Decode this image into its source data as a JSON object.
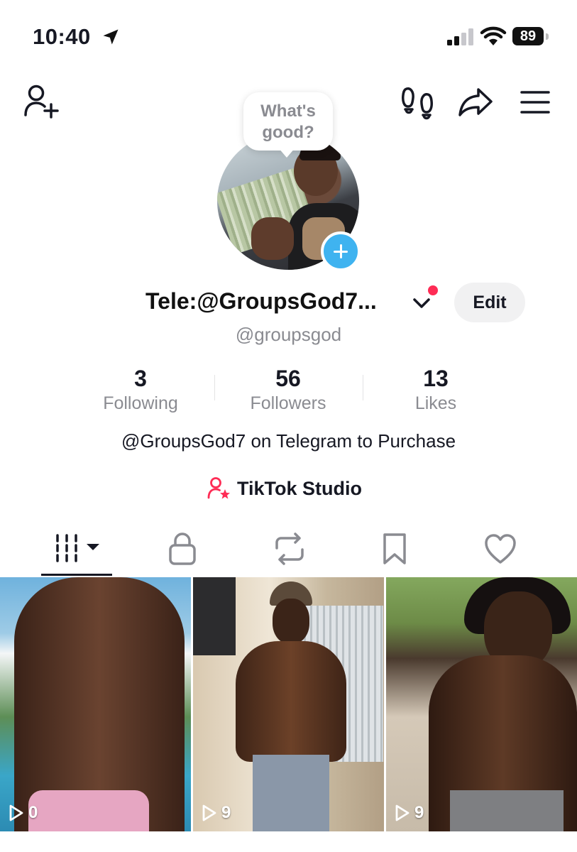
{
  "status_bar": {
    "time": "10:40",
    "battery": "89"
  },
  "profile": {
    "bubble_text": "What's good?",
    "display_name": "Tele:@GroupsGod7...",
    "handle": "@groupsgod",
    "edit_label": "Edit",
    "bio": "@GroupsGod7 on Telegram to Purchase",
    "studio_label": "TikTok Studio"
  },
  "stats": [
    {
      "value": "3",
      "label": "Following"
    },
    {
      "value": "56",
      "label": "Followers"
    },
    {
      "value": "13",
      "label": "Likes"
    }
  ],
  "tabs": [
    {
      "icon": "videos-grid-icon",
      "active": true
    },
    {
      "icon": "lock-icon",
      "active": false
    },
    {
      "icon": "repost-icon",
      "active": false
    },
    {
      "icon": "bookmark-icon",
      "active": false
    },
    {
      "icon": "heart-icon",
      "active": false
    }
  ],
  "videos": [
    {
      "views": "0"
    },
    {
      "views": "9"
    },
    {
      "views": "9"
    }
  ],
  "colors": {
    "accent_red": "#fe2c55",
    "badge_blue": "#3fb3f0",
    "secondary_text": "#8a8b91"
  }
}
